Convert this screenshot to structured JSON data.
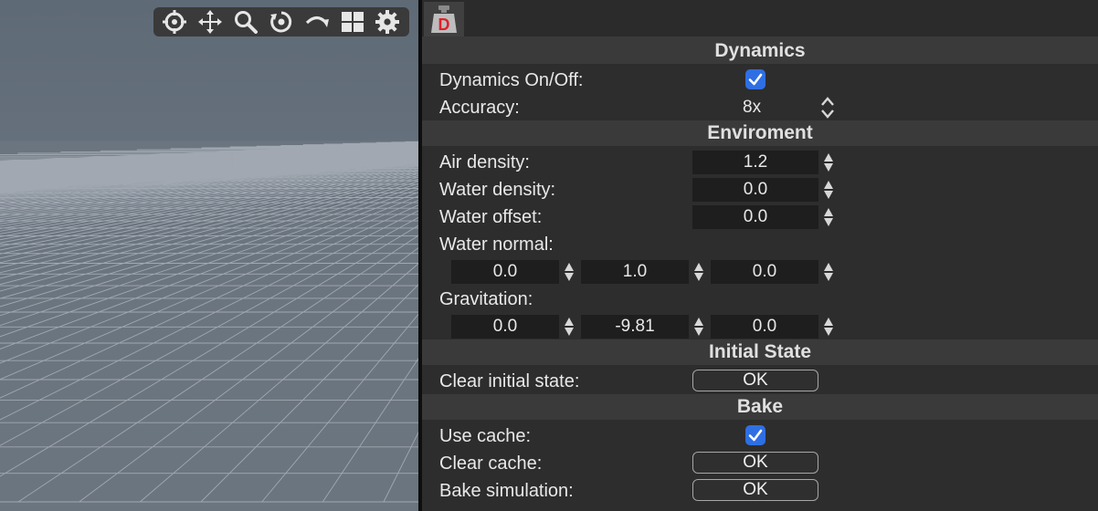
{
  "toolbar": {
    "icons": [
      "crosshair-icon",
      "move-icon",
      "zoom-icon",
      "orbit-icon",
      "rotate-icon",
      "layout-icon",
      "gear-icon"
    ]
  },
  "tab": {
    "icon": "weight-icon",
    "letter": "D"
  },
  "sections": {
    "dynamics": "Dynamics",
    "environment": "Enviroment",
    "initial_state": "Initial State",
    "bake": "Bake"
  },
  "dynamics": {
    "on_off_label": "Dynamics On/Off:",
    "on_off_checked": true,
    "accuracy_label": "Accuracy:",
    "accuracy_value": "8x"
  },
  "environment": {
    "air_density_label": "Air density:",
    "air_density": "1.2",
    "water_density_label": "Water density:",
    "water_density": "0.0",
    "water_offset_label": "Water offset:",
    "water_offset": "0.0",
    "water_normal_label": "Water normal:",
    "water_normal": [
      "0.0",
      "1.0",
      "0.0"
    ],
    "gravitation_label": "Gravitation:",
    "gravitation": [
      "0.0",
      "-9.81",
      "0.0"
    ]
  },
  "initial_state": {
    "clear_label": "Clear initial state:",
    "clear_button": "OK"
  },
  "bake": {
    "use_cache_label": "Use cache:",
    "use_cache_checked": true,
    "clear_cache_label": "Clear cache:",
    "clear_cache_button": "OK",
    "bake_sim_label": "Bake simulation:",
    "bake_sim_button": "OK"
  },
  "colors": {
    "accent": "#2f6fe4",
    "tab_letter": "#e0202a"
  }
}
